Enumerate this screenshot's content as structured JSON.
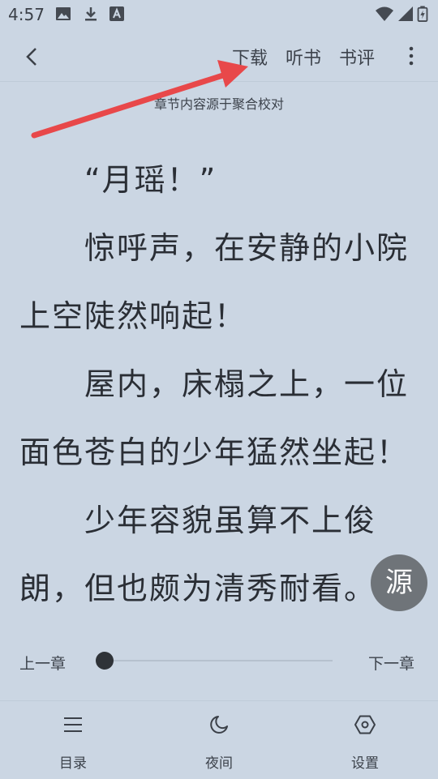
{
  "status_bar": {
    "time": "4:57",
    "left_icons": [
      "image-icon",
      "download-icon",
      "font-a-icon"
    ],
    "right_icons": [
      "wifi-icon",
      "signal-icon",
      "battery-charging-icon"
    ]
  },
  "top_bar": {
    "back_icon": "chevron-left-icon",
    "menu": {
      "download": "下载",
      "listen": "听书",
      "review": "书评"
    },
    "more_icon": "more-vertical-icon"
  },
  "source_note": "章节内容源于聚合校对",
  "content": {
    "paragraphs": [
      {
        "text": "“月瑶！”"
      },
      {
        "text": "惊呼声，在安静的小院上空陡然响起！"
      },
      {
        "text": "屋内，床榻之上，一位面色苍白的少年猛然坐起！"
      },
      {
        "text": "少年容貌虽算不上俊朗，但也颇为清秀耐看。"
      }
    ]
  },
  "source_button": "源",
  "chapter_nav": {
    "prev": "上一章",
    "next": "下一章",
    "progress": 0
  },
  "bottom_tabs": [
    {
      "label": "目录",
      "icon": "list-icon"
    },
    {
      "label": "夜间",
      "icon": "moon-icon"
    },
    {
      "label": "设置",
      "icon": "settings-hexagon-icon"
    }
  ],
  "colors": {
    "background": "#cbd6e3",
    "annotation_arrow": "#e8484a",
    "fab": "#6f7479"
  }
}
